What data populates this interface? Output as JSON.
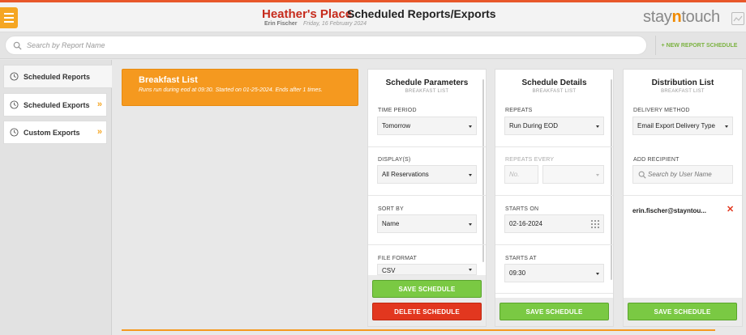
{
  "header": {
    "hotel_name": "Heather's Place",
    "page_title": "Scheduled Reports/Exports",
    "user_name": "Erin Fischer",
    "date": "Friday, 16 February 2024",
    "logo_part1": "stay",
    "logo_part2": "n",
    "logo_part3": "touch",
    "colors": {
      "accent": "#f5a623",
      "brand_red": "#c62b1c",
      "green": "#7ac943",
      "red": "#e2371f"
    }
  },
  "search": {
    "placeholder": "Search by Report Name",
    "new_report_label": "+ NEW REPORT SCHEDULE"
  },
  "sidebar": {
    "items": [
      {
        "label": "Scheduled Reports",
        "icon": "clock-icon",
        "active": true
      },
      {
        "label": "Scheduled Exports",
        "icon": "clock-icon",
        "chevron": "»"
      },
      {
        "label": "Custom Exports",
        "icon": "clock-icon",
        "chevron": "»"
      }
    ]
  },
  "report": {
    "title": "Breakfast List",
    "description": "Runs run during eod at 09:30. Started on 01-25-2024. Ends after 1 times."
  },
  "parameters": {
    "title": "Schedule Parameters",
    "subtitle": "BREAKFAST LIST",
    "time_period_label": "TIME PERIOD",
    "time_period_value": "Tomorrow",
    "display_label": "DISPLAY(S)",
    "display_value": "All Reservations",
    "sort_label": "SORT BY",
    "sort_value": "Name",
    "format_label": "FILE FORMAT",
    "format_value": "CSV",
    "save_label": "SAVE SCHEDULE",
    "delete_label": "DELETE SCHEDULE"
  },
  "details": {
    "title": "Schedule Details",
    "subtitle": "BREAKFAST LIST",
    "repeats_label": "REPEATS",
    "repeats_value": "Run During EOD",
    "repeats_every_label": "REPEATS EVERY",
    "repeats_every_value": "No.",
    "starts_on_label": "STARTS ON",
    "starts_on_value": "02-16-2024",
    "starts_at_label": "STARTS AT",
    "starts_at_value": "09:30",
    "save_label": "SAVE SCHEDULE"
  },
  "distribution": {
    "title": "Distribution List",
    "subtitle": "BREAKFAST LIST",
    "delivery_label": "DELIVERY METHOD",
    "delivery_value": "Email Export Delivery Type",
    "add_recipient_label": "ADD RECIPIENT",
    "recipient_placeholder": "Search by User Name",
    "recipients": [
      "erin.fischer@stayntou..."
    ],
    "save_label": "SAVE SCHEDULE"
  }
}
